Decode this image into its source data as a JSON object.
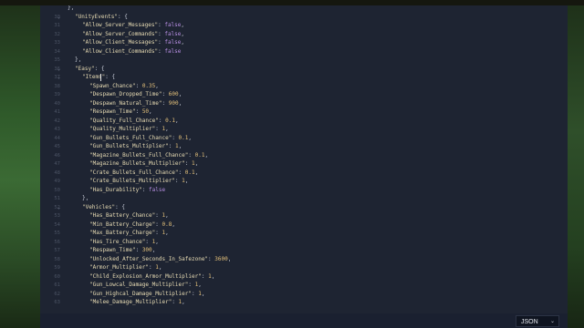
{
  "editor": {
    "lines": [
      {
        "num": "",
        "fold": false,
        "indent": 0,
        "segs": [
          [
            "p",
            "},"
          ]
        ]
      },
      {
        "num": "30",
        "fold": true,
        "indent": 1,
        "segs": [
          [
            "k",
            "\"UnityEvents\""
          ],
          [
            "p",
            ": {"
          ]
        ]
      },
      {
        "num": "31",
        "fold": false,
        "indent": 2,
        "segs": [
          [
            "k",
            "\"Allow_Server_Messages\""
          ],
          [
            "p",
            ": "
          ],
          [
            "b",
            "false"
          ],
          [
            "p",
            ","
          ]
        ]
      },
      {
        "num": "32",
        "fold": false,
        "indent": 2,
        "segs": [
          [
            "k",
            "\"Allow_Server_Commands\""
          ],
          [
            "p",
            ": "
          ],
          [
            "b",
            "false"
          ],
          [
            "p",
            ","
          ]
        ]
      },
      {
        "num": "33",
        "fold": false,
        "indent": 2,
        "segs": [
          [
            "k",
            "\"Allow_Client_Messages\""
          ],
          [
            "p",
            ": "
          ],
          [
            "b",
            "false"
          ],
          [
            "p",
            ","
          ]
        ]
      },
      {
        "num": "34",
        "fold": false,
        "indent": 2,
        "segs": [
          [
            "k",
            "\"Allow_Client_Commands\""
          ],
          [
            "p",
            ": "
          ],
          [
            "b",
            "false"
          ]
        ]
      },
      {
        "num": "35",
        "fold": false,
        "indent": 1,
        "segs": [
          [
            "p",
            "},"
          ]
        ]
      },
      {
        "num": "36",
        "fold": true,
        "indent": 1,
        "segs": [
          [
            "k",
            "\"Easy\""
          ],
          [
            "p",
            ": {"
          ]
        ]
      },
      {
        "num": "37",
        "fold": true,
        "indent": 2,
        "segs": [
          [
            "k",
            "\"Items\""
          ],
          [
            "p",
            ": {"
          ]
        ]
      },
      {
        "num": "38",
        "fold": false,
        "indent": 3,
        "segs": [
          [
            "k",
            "\"Spawn_Chance\""
          ],
          [
            "p",
            ": "
          ],
          [
            "n",
            "0.35"
          ],
          [
            "p",
            ","
          ]
        ]
      },
      {
        "num": "39",
        "fold": false,
        "indent": 3,
        "segs": [
          [
            "k",
            "\"Despawn_Dropped_Time\""
          ],
          [
            "p",
            ": "
          ],
          [
            "n",
            "600"
          ],
          [
            "p",
            ","
          ]
        ]
      },
      {
        "num": "40",
        "fold": false,
        "indent": 3,
        "segs": [
          [
            "k",
            "\"Despawn_Natural_Time\""
          ],
          [
            "p",
            ": "
          ],
          [
            "n",
            "900"
          ],
          [
            "p",
            ","
          ]
        ]
      },
      {
        "num": "41",
        "fold": false,
        "indent": 3,
        "segs": [
          [
            "k",
            "\"Respawn_Time\""
          ],
          [
            "p",
            ": "
          ],
          [
            "n",
            "50"
          ],
          [
            "p",
            ","
          ]
        ]
      },
      {
        "num": "42",
        "fold": false,
        "indent": 3,
        "segs": [
          [
            "k",
            "\"Quality_Full_Chance\""
          ],
          [
            "p",
            ": "
          ],
          [
            "n",
            "0.1"
          ],
          [
            "p",
            ","
          ]
        ]
      },
      {
        "num": "43",
        "fold": false,
        "indent": 3,
        "segs": [
          [
            "k",
            "\"Quality_Multiplier\""
          ],
          [
            "p",
            ": "
          ],
          [
            "n",
            "1"
          ],
          [
            "p",
            ","
          ]
        ]
      },
      {
        "num": "44",
        "fold": false,
        "indent": 3,
        "segs": [
          [
            "k",
            "\"Gun_Bullets_Full_Chance\""
          ],
          [
            "p",
            ": "
          ],
          [
            "n",
            "0.1"
          ],
          [
            "p",
            ","
          ]
        ]
      },
      {
        "num": "45",
        "fold": false,
        "indent": 3,
        "segs": [
          [
            "k",
            "\"Gun_Bullets_Multiplier\""
          ],
          [
            "p",
            ": "
          ],
          [
            "n",
            "1"
          ],
          [
            "p",
            ","
          ]
        ]
      },
      {
        "num": "46",
        "fold": false,
        "indent": 3,
        "segs": [
          [
            "k",
            "\"Magazine_Bullets_Full_Chance\""
          ],
          [
            "p",
            ": "
          ],
          [
            "n",
            "0.1"
          ],
          [
            "p",
            ","
          ]
        ]
      },
      {
        "num": "47",
        "fold": false,
        "indent": 3,
        "segs": [
          [
            "k",
            "\"Magazine_Bullets_Multiplier\""
          ],
          [
            "p",
            ": "
          ],
          [
            "n",
            "1"
          ],
          [
            "p",
            ","
          ]
        ]
      },
      {
        "num": "48",
        "fold": false,
        "indent": 3,
        "segs": [
          [
            "k",
            "\"Crate_Bullets_Full_Chance\""
          ],
          [
            "p",
            ": "
          ],
          [
            "n",
            "0.1"
          ],
          [
            "p",
            ","
          ]
        ]
      },
      {
        "num": "49",
        "fold": false,
        "indent": 3,
        "segs": [
          [
            "k",
            "\"Crate_Bullets_Multiplier\""
          ],
          [
            "p",
            ": "
          ],
          [
            "n",
            "1"
          ],
          [
            "p",
            ","
          ]
        ]
      },
      {
        "num": "50",
        "fold": false,
        "indent": 3,
        "segs": [
          [
            "k",
            "\"Has_Durability\""
          ],
          [
            "p",
            ": "
          ],
          [
            "b",
            "false"
          ]
        ]
      },
      {
        "num": "51",
        "fold": false,
        "indent": 2,
        "segs": [
          [
            "p",
            "},"
          ]
        ]
      },
      {
        "num": "52",
        "fold": true,
        "indent": 2,
        "segs": [
          [
            "k",
            "\"Vehicles\""
          ],
          [
            "p",
            ": {"
          ]
        ]
      },
      {
        "num": "53",
        "fold": false,
        "indent": 3,
        "segs": [
          [
            "k",
            "\"Has_Battery_Chance\""
          ],
          [
            "p",
            ": "
          ],
          [
            "n",
            "1"
          ],
          [
            "p",
            ","
          ]
        ]
      },
      {
        "num": "54",
        "fold": false,
        "indent": 3,
        "segs": [
          [
            "k",
            "\"Min_Battery_Charge\""
          ],
          [
            "p",
            ": "
          ],
          [
            "n",
            "0.8"
          ],
          [
            "p",
            ","
          ]
        ]
      },
      {
        "num": "55",
        "fold": false,
        "indent": 3,
        "segs": [
          [
            "k",
            "\"Max_Battery_Charge\""
          ],
          [
            "p",
            ": "
          ],
          [
            "n",
            "1"
          ],
          [
            "p",
            ","
          ]
        ]
      },
      {
        "num": "56",
        "fold": false,
        "indent": 3,
        "segs": [
          [
            "k",
            "\"Has_Tire_Chance\""
          ],
          [
            "p",
            ": "
          ],
          [
            "n",
            "1"
          ],
          [
            "p",
            ","
          ]
        ]
      },
      {
        "num": "57",
        "fold": false,
        "indent": 3,
        "segs": [
          [
            "k",
            "\"Respawn_Time\""
          ],
          [
            "p",
            ": "
          ],
          [
            "n",
            "300"
          ],
          [
            "p",
            ","
          ]
        ]
      },
      {
        "num": "58",
        "fold": false,
        "indent": 3,
        "segs": [
          [
            "k",
            "\"Unlocked_After_Seconds_In_Safezone\""
          ],
          [
            "p",
            ": "
          ],
          [
            "n",
            "3600"
          ],
          [
            "p",
            ","
          ]
        ]
      },
      {
        "num": "59",
        "fold": false,
        "indent": 3,
        "segs": [
          [
            "k",
            "\"Armor_Multiplier\""
          ],
          [
            "p",
            ": "
          ],
          [
            "n",
            "1"
          ],
          [
            "p",
            ","
          ]
        ]
      },
      {
        "num": "60",
        "fold": false,
        "indent": 3,
        "segs": [
          [
            "k",
            "\"Child_Explosion_Armor_Multiplier\""
          ],
          [
            "p",
            ": "
          ],
          [
            "n",
            "1"
          ],
          [
            "p",
            ","
          ]
        ]
      },
      {
        "num": "61",
        "fold": false,
        "indent": 3,
        "segs": [
          [
            "k",
            "\"Gun_Lowcal_Damage_Multiplier\""
          ],
          [
            "p",
            ": "
          ],
          [
            "n",
            "1"
          ],
          [
            "p",
            ","
          ]
        ]
      },
      {
        "num": "62",
        "fold": false,
        "indent": 3,
        "segs": [
          [
            "k",
            "\"Gun_Highcal_Damage_Multiplier\""
          ],
          [
            "p",
            ": "
          ],
          [
            "n",
            "1"
          ],
          [
            "p",
            ","
          ]
        ]
      },
      {
        "num": "63",
        "fold": false,
        "indent": 3,
        "segs": [
          [
            "k",
            "\"Melee_Damage_Multiplier\""
          ],
          [
            "p",
            ": "
          ],
          [
            "n",
            "1"
          ],
          [
            "p",
            ","
          ]
        ]
      }
    ],
    "fold_glyph": "⌄"
  },
  "statusbar": {
    "language": "JSON",
    "chevron": "⌄"
  },
  "colors": {
    "editor_bg": "#1e2432",
    "key": "#e8dcb4",
    "number": "#e3c07a",
    "boolean": "#b58de0"
  }
}
